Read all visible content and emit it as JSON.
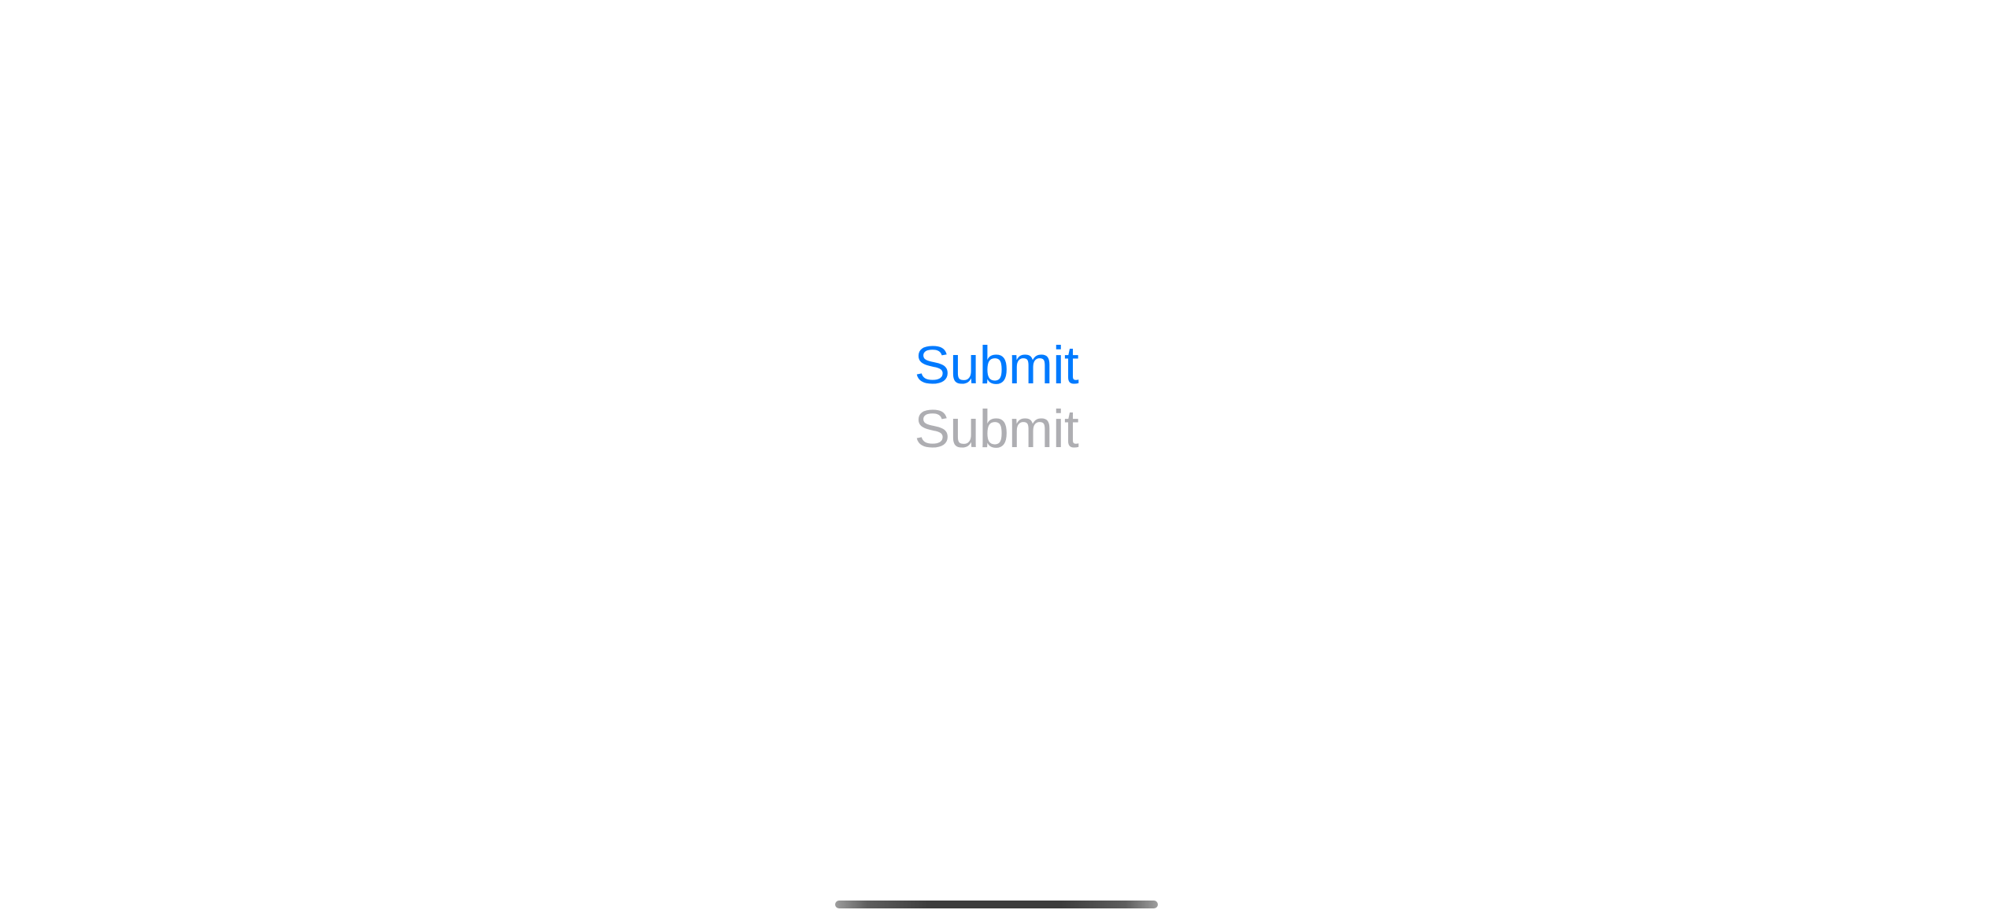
{
  "buttons": {
    "submit_enabled": {
      "label": "Submit"
    },
    "submit_disabled": {
      "label": "Submit"
    }
  },
  "colors": {
    "accent": "#007AFF",
    "disabled": "#AEAEB2"
  }
}
